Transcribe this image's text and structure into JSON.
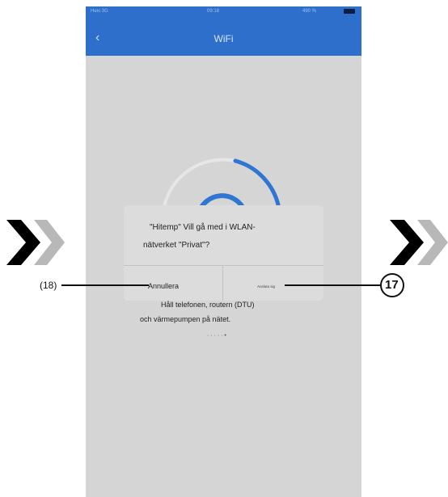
{
  "status_bar": {
    "carrier": "Hexi 3G",
    "time": "09:18",
    "battery": "490 %"
  },
  "nav": {
    "title": "WiFi",
    "back_icon": "chevron-left-icon"
  },
  "dialog": {
    "message_line1": "\"Hitemp\" Vill gå med i WLAN-",
    "message_line2": "nätverket \"Privat\"?",
    "cancel_label": "Annullera",
    "connect_label": "Ansluta sig"
  },
  "hint": {
    "line1": "Håll telefonen, routern (DTU)",
    "line2": "och värmepumpen på nätet.",
    "dots": "· · · · · •"
  },
  "callouts": {
    "left": "(18)",
    "right": "17"
  },
  "colors": {
    "accent": "#2d6fcb",
    "spinner": "#2f76d2",
    "overlay": "#d5d5d5"
  }
}
